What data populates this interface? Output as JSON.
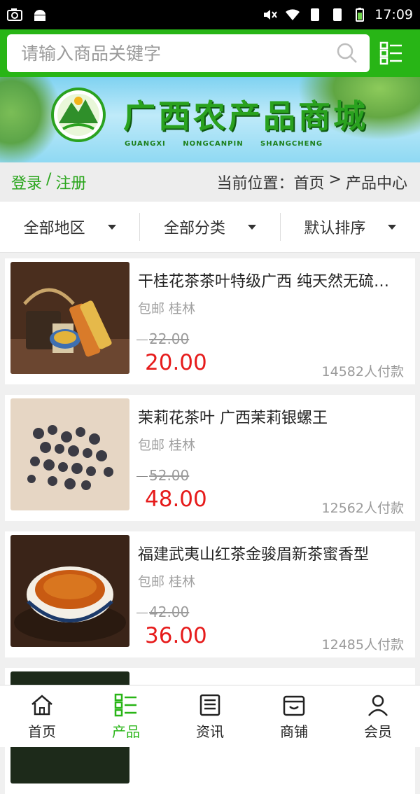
{
  "status_bar": {
    "time": "17:09"
  },
  "search": {
    "placeholder": "请输入商品关键字"
  },
  "banner": {
    "title": "广西农产品商城",
    "subtitle": "GUANGXI NONGCANPIN SHANGCHENG"
  },
  "auth": {
    "login": "登录",
    "separator": "/",
    "register": "注册"
  },
  "breadcrumb": {
    "label": "当前位置：",
    "home": "首页",
    "sep": ">",
    "current": "产品中心"
  },
  "filters": [
    {
      "label": "全部地区"
    },
    {
      "label": "全部分类"
    },
    {
      "label": "默认排序"
    }
  ],
  "products": [
    {
      "name": "干桂花茶茶叶特级广西 纯天然无硫桂花茶",
      "tag1": "包邮",
      "tag2": "桂林",
      "old_price": "22.00",
      "price": "20.00",
      "sold": "14582人付款"
    },
    {
      "name": "茉莉花茶叶 广西茉莉银螺王",
      "tag1": "包邮",
      "tag2": "桂林",
      "old_price": "52.00",
      "price": "48.00",
      "sold": "12562人付款"
    },
    {
      "name": "福建武夷山红茶金骏眉新茶蜜香型",
      "tag1": "包邮",
      "tag2": "桂林",
      "old_price": "42.00",
      "price": "36.00",
      "sold": "12485人付款"
    }
  ],
  "tabs": [
    {
      "label": "首页",
      "icon": "home-icon"
    },
    {
      "label": "产品",
      "icon": "list-icon"
    },
    {
      "label": "资讯",
      "icon": "news-icon"
    },
    {
      "label": "商铺",
      "icon": "shop-icon"
    },
    {
      "label": "会员",
      "icon": "user-icon"
    }
  ],
  "colors": {
    "brand_green": "#28b516",
    "price_red": "#e61b1b"
  }
}
